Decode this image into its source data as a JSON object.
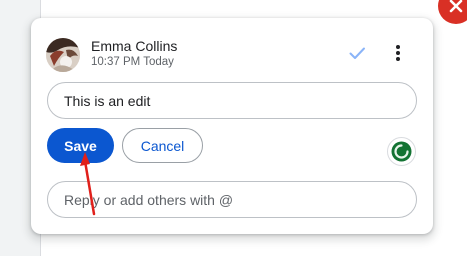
{
  "comment": {
    "author_name": "Emma Collins",
    "timestamp": "10:37 PM Today",
    "edit_value": "This is an edit",
    "reply_placeholder": "Reply or add others with @"
  },
  "actions": {
    "save_label": "Save",
    "cancel_label": "Cancel"
  },
  "icons": {
    "resolve": "checkmark-icon",
    "more": "more-vert-icon",
    "close": "close-icon",
    "status": "status-ring-icon"
  },
  "colors": {
    "primary": "#0b57d0",
    "close_badge": "#d93025",
    "status_ring": "#137333",
    "annotation_arrow": "#e0201b"
  }
}
